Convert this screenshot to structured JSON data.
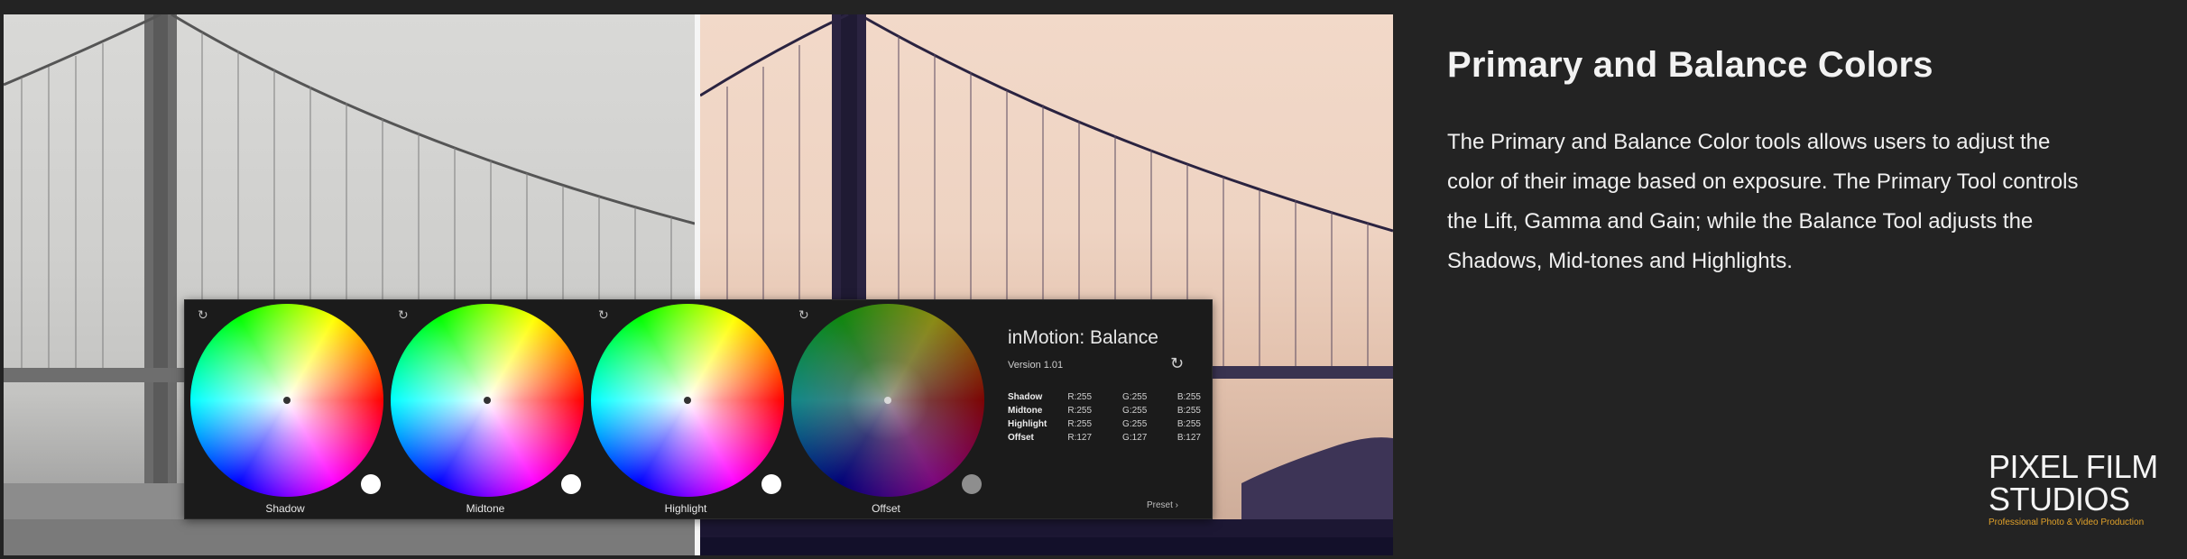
{
  "section": {
    "heading": "Primary and Balance Colors",
    "body": "The Primary and Balance Color tools allows users to adjust the color of their image based on exposure. The Primary Tool controls the Lift, Gamma and Gain; while the Balance Tool adjusts the Shadows, Mid-tones and Highlights."
  },
  "panel": {
    "title": "inMotion: Balance",
    "version": "Version 1.01",
    "preset_label": "Preset ›",
    "wheels": [
      {
        "label": "Shadow"
      },
      {
        "label": "Midtone"
      },
      {
        "label": "Highlight"
      },
      {
        "label": "Offset"
      }
    ],
    "values": [
      {
        "name": "Shadow",
        "r": "R:255",
        "g": "G:255",
        "b": "B:255"
      },
      {
        "name": "Midtone",
        "r": "R:255",
        "g": "G:255",
        "b": "B:255"
      },
      {
        "name": "Highlight",
        "r": "R:255",
        "g": "G:255",
        "b": "B:255"
      },
      {
        "name": "Offset",
        "r": "R:127",
        "g": "G:127",
        "b": "B:127"
      }
    ]
  },
  "logo": {
    "line1": "PIXEL FILM",
    "line2": "STUDIOS",
    "tagline": "Professional Photo & Video Production"
  },
  "colors": {
    "background": "#232323",
    "logo_accent": "#e0a12a"
  }
}
